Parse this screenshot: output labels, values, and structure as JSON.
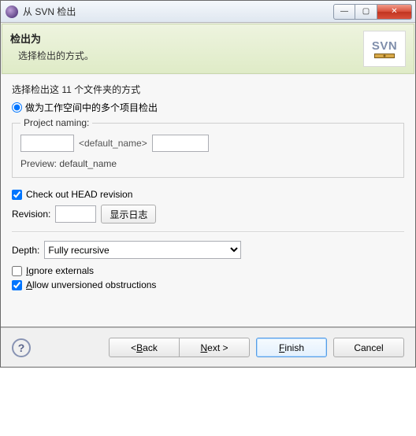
{
  "window": {
    "title": "从 SVN 检出"
  },
  "banner": {
    "title": "检出为",
    "subtitle": "选择检出的方式。",
    "logo_text": "SVN"
  },
  "body": {
    "section_label": "选择检出这 11 个文件夹的方式",
    "radio_option": "做为工作空间中的多个项目检出",
    "project_naming_legend": "Project naming:",
    "default_name_placeholder": "<default_name>",
    "preview_label": "Preview: default_name",
    "head_rev_label": "Check out HEAD revision",
    "revision_label": "Revision:",
    "show_log_btn": "显示日志",
    "depth_label": "Depth:",
    "depth_value": "Fully recursive",
    "ignore_externals_pre": "I",
    "ignore_externals_post": "gnore externals",
    "allow_unversioned_pre": "A",
    "allow_unversioned_post": "llow unversioned obstructions"
  },
  "footer": {
    "help": "?",
    "back_pre": "< ",
    "back_u": "B",
    "back_post": "ack",
    "next_u": "N",
    "next_post": "ext >",
    "finish_u": "F",
    "finish_post": "inish",
    "cancel": "Cancel"
  }
}
